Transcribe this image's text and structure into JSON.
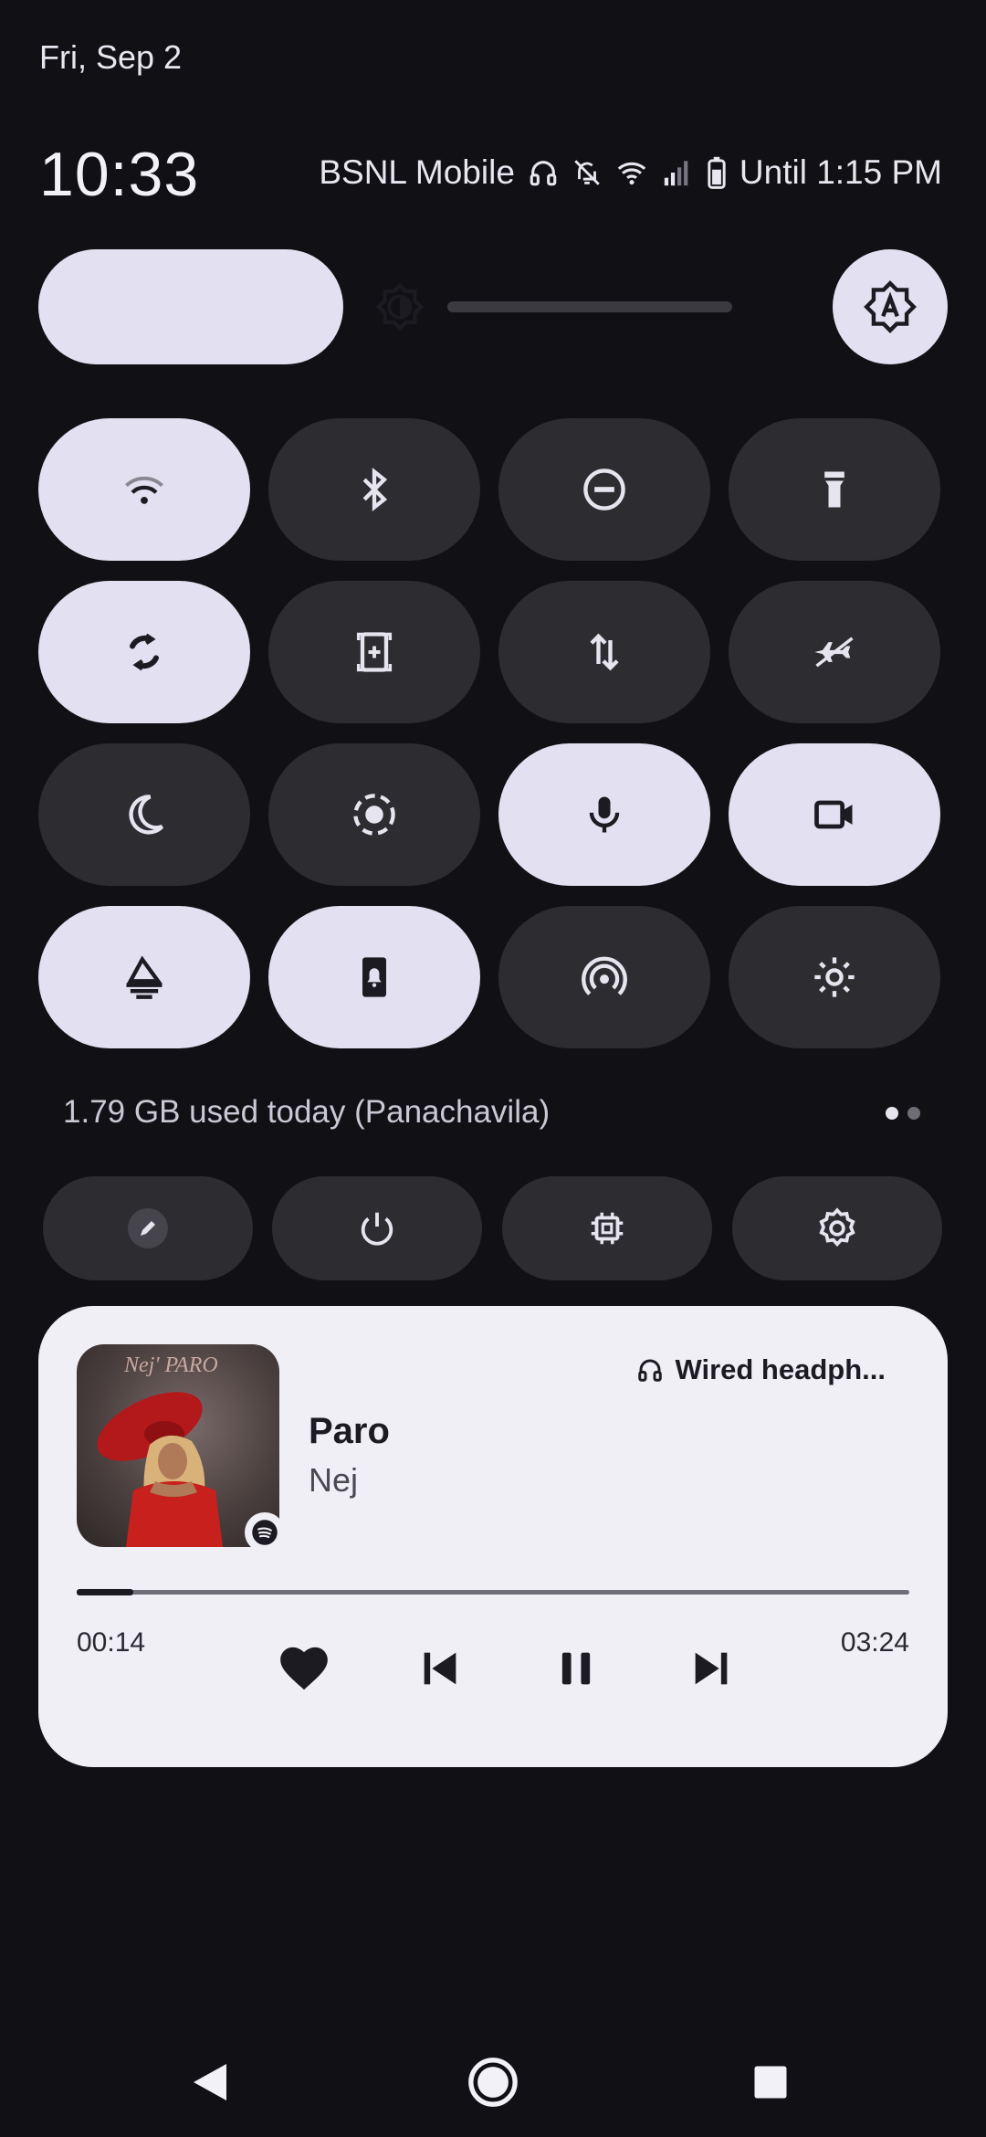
{
  "status_bar": {
    "date": "Fri, Sep 2",
    "time": "10:33",
    "carrier": "BSNL Mobile",
    "battery_text": "Until 1:15 PM",
    "icons": [
      "headphones-icon",
      "notifications-off-icon",
      "wifi-icon",
      "signal-icon",
      "battery-icon"
    ]
  },
  "brightness": {
    "level": 0.44,
    "auto_icon": "auto-brightness-icon"
  },
  "tiles": [
    {
      "icon": "wifi-icon",
      "state": "on"
    },
    {
      "icon": "bluetooth-icon",
      "state": "off"
    },
    {
      "icon": "do-not-disturb-icon",
      "state": "off"
    },
    {
      "icon": "flashlight-icon",
      "state": "off"
    },
    {
      "icon": "auto-rotate-icon",
      "state": "on"
    },
    {
      "icon": "screenshot-icon",
      "state": "off"
    },
    {
      "icon": "mobile-data-icon",
      "state": "off"
    },
    {
      "icon": "airplane-mode-icon",
      "state": "off"
    },
    {
      "icon": "dark-theme-icon",
      "state": "off"
    },
    {
      "icon": "screen-record-icon",
      "state": "off"
    },
    {
      "icon": "microphone-icon",
      "state": "on"
    },
    {
      "icon": "camera-icon",
      "state": "on"
    },
    {
      "icon": "eye-comfort-icon",
      "state": "on"
    },
    {
      "icon": "sound-mode-icon",
      "state": "on"
    },
    {
      "icon": "hotspot-icon",
      "state": "off"
    },
    {
      "icon": "brightness-icon",
      "state": "off"
    }
  ],
  "data_usage": "1.79 GB used today (Panachavila)",
  "footer_buttons": [
    "edit-icon",
    "power-icon",
    "device-info-icon",
    "settings-icon"
  ],
  "media": {
    "output_device": "Wired headph...",
    "title": "Paro",
    "artist": "Nej",
    "elapsed": "00:14",
    "duration": "03:24",
    "progress": 0.068,
    "album_art_text": "Nej' PARO",
    "colors": {
      "card": "#f0eff6",
      "dress": "#c8201c"
    }
  },
  "nav": [
    "back-icon",
    "home-icon",
    "recents-icon"
  ],
  "colors": {
    "background": "#101015",
    "tile_on": "#e3e1f1",
    "tile_off": "#2c2c31"
  }
}
